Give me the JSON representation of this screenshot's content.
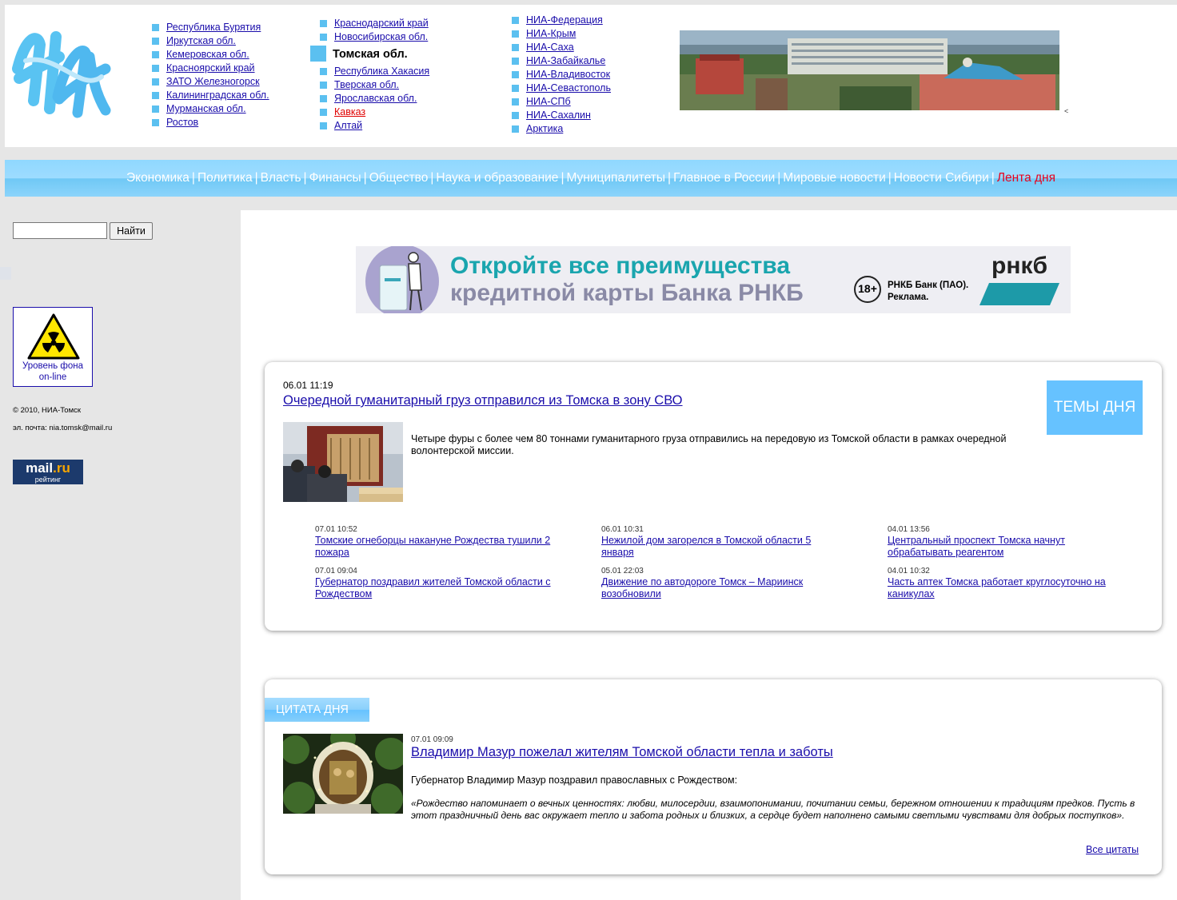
{
  "header": {
    "logo_text": "НИА",
    "regions_col1": [
      "Республика Бурятия",
      "Иркутская обл.",
      "Кемеровская обл.",
      "Красноярский край",
      "ЗАТО Железногорск",
      "Калининградская обл.",
      "Мурманская обл.",
      "Ростов"
    ],
    "regions_col2_top": [
      "Краснодарский край",
      "Новосибирская обл."
    ],
    "current_region": "Томская обл.",
    "regions_col2_bottom": [
      "Республика Хакасия",
      "Тверская обл.",
      "Ярославская обл.",
      "Кавказ",
      "Алтай"
    ],
    "regions_col3": [
      "НИА-Федерация",
      "НИА-Крым",
      "НИА-Саха",
      "НИА-Забайкалье",
      "НИА-Владивосток",
      "НИА-Севастополь",
      "НИА-СПб",
      "НИА-Сахалин",
      "Арктика"
    ],
    "photo_caret": "<"
  },
  "nav": {
    "items": [
      "Экономика",
      "Политика",
      "Власть",
      "Финансы",
      "Общество",
      "Наука и образование",
      "Муниципалитеты",
      "Главное в России",
      "Мировые новости",
      "Новости Сибири"
    ],
    "highlight": "Лента дня",
    "separator": "|"
  },
  "sidebar": {
    "search_button": "Найти",
    "search_value": "",
    "radiation_label_1": "Уровень фона",
    "radiation_label_2": "on-line",
    "copyright": "© 2010, НИА-Томск",
    "email": "эл. почта: nia.tomsk@mail.ru",
    "mailru_logo_a": "mail",
    "mailru_logo_b": ".ru",
    "mailru_sub": "рейтинг"
  },
  "banner": {
    "line1": "Откройте все преимущества",
    "line2": "кредитной карты Банка РНКБ",
    "age": "18+",
    "disclaimer_1": "РНКБ Банк (ПАО).",
    "disclaimer_2": "Реклама.",
    "brand": "рнкб"
  },
  "topics": {
    "badge": "ТЕМЫ ДНЯ",
    "lead": {
      "date": "06.01 11:19",
      "title": "Очередной гуманитарный груз отправился из Томска в зону СВО",
      "summary": "Четыре фуры с более чем 80 тоннами гуманитарного груза отправились на передовую из Томской области в рамках очередной волонтерской миссии."
    },
    "items": [
      {
        "date": "07.01 10:52",
        "title": "Томские огнеборцы накануне Рождества тушили 2 пожара"
      },
      {
        "date": "06.01 10:31",
        "title": "Нежилой дом загорелся в Томской области 5 января"
      },
      {
        "date": "04.01 13:56",
        "title": "Центральный проспект Томска начнут обрабатывать реагентом"
      },
      {
        "date": "07.01 09:04",
        "title": "Губернатор поздравил жителей Томской области с Рождеством"
      },
      {
        "date": "05.01 22:03",
        "title": "Движение по автодороге Томск – Мариинск возобновили"
      },
      {
        "date": "04.01 10:32",
        "title": "Часть аптек Томска работает круглосуточно на каникулах"
      }
    ]
  },
  "quote": {
    "badge": "ЦИТАТА ДНЯ",
    "date": "07.01 09:09",
    "title": "Владимир Мазур пожелал жителям Томской области тепла и заботы",
    "intro": "Губернатор Владимир Мазур поздравил православных с Рождеством:",
    "text": "«Рождество напоминает о вечных ценностях: любви, милосердии, взаимопонимании, почитании семьи, бережном отношении к традициям предков. Пусть в этот праздничный день вас окружает тепло и забота родных и близких, а сердце будет наполнено самыми светлыми чувствами для добрых поступков».",
    "all_link": "Все цитаты"
  },
  "colors": {
    "accent": "#66c2ff",
    "link": "#1a0dab",
    "highlight": "#e8001c"
  }
}
